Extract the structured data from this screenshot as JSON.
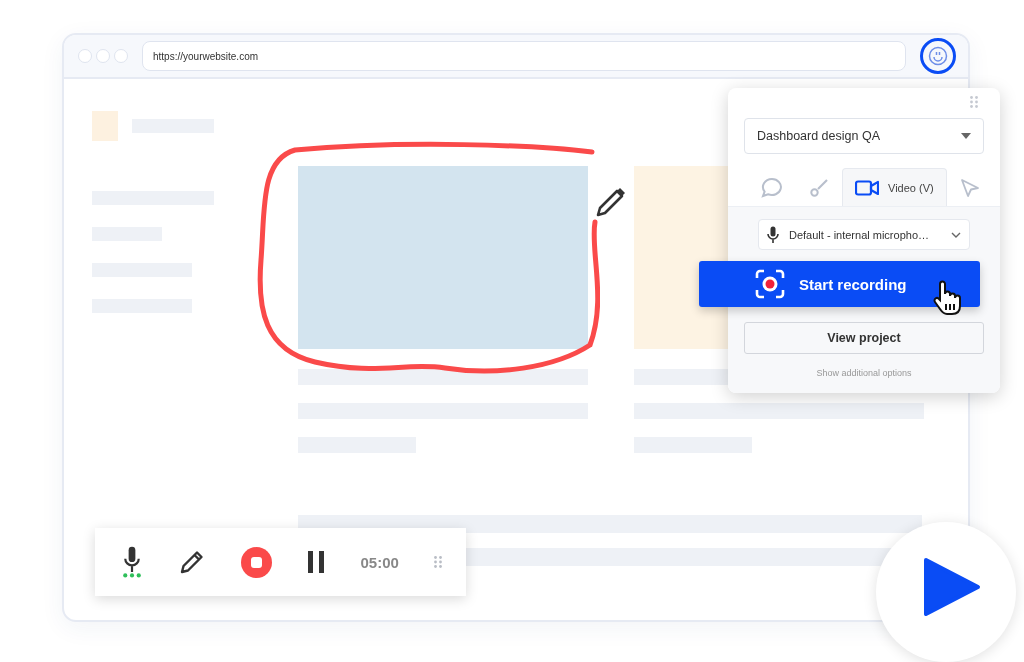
{
  "browser": {
    "url": "https://yourwebsite.com",
    "extension_active": true
  },
  "panel": {
    "project": "Dashboard design QA",
    "tabs": [
      {
        "kind": "comment",
        "selected": false
      },
      {
        "kind": "brush",
        "selected": false
      },
      {
        "kind": "video",
        "label": "Video (V)",
        "selected": true
      },
      {
        "kind": "pointer",
        "selected": false
      }
    ],
    "microphone": "Default - internal micropho…",
    "start_button": "Start recording",
    "view_button": "View project",
    "more_link": "Show additional options"
  },
  "toolbar": {
    "tools": [
      {
        "kind": "mic"
      },
      {
        "kind": "pencil"
      },
      {
        "kind": "stop"
      },
      {
        "kind": "pause"
      }
    ],
    "timer": "05:00"
  }
}
